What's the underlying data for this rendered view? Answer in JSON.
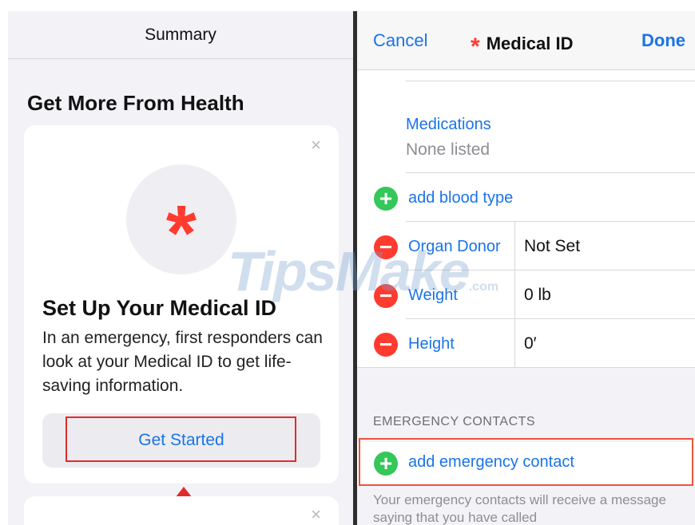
{
  "left": {
    "header_title": "Summary",
    "section_title": "Get More From Health",
    "card": {
      "close_glyph": "×",
      "icon": "asterisk-icon",
      "icon_glyph": "*",
      "title": "Set Up Your Medical ID",
      "body": "In an emergency, first responders can look at your Medical ID to get life-saving information.",
      "button_label": "Get Started"
    },
    "card2": {
      "close_glyph": "×"
    }
  },
  "right": {
    "nav": {
      "cancel_label": "Cancel",
      "title_icon_glyph": "*",
      "title": "Medical ID",
      "done_label": "Done"
    },
    "medications": {
      "label": "Medications",
      "value": "None listed"
    },
    "rows": [
      {
        "type": "add",
        "glyph": "+",
        "label": "add blood type",
        "value": ""
      },
      {
        "type": "remove",
        "glyph": "−",
        "label": "Organ Donor",
        "value": "Not Set"
      },
      {
        "type": "remove",
        "glyph": "−",
        "label": "Weight",
        "value": "0 lb"
      },
      {
        "type": "remove",
        "glyph": "−",
        "label": "Height",
        "value": "0′"
      }
    ],
    "emergency": {
      "header": "EMERGENCY CONTACTS",
      "add_glyph": "+",
      "add_label": "add emergency contact",
      "note": "Your emergency contacts will receive a message saying that you have called"
    }
  },
  "watermark": {
    "text": "TipsMake",
    "suffix": ".com"
  },
  "colors": {
    "accent_blue": "#1a73e8",
    "medical_red": "#ff3b30",
    "add_green": "#34c759",
    "highlight_red": "#e02b2b"
  }
}
